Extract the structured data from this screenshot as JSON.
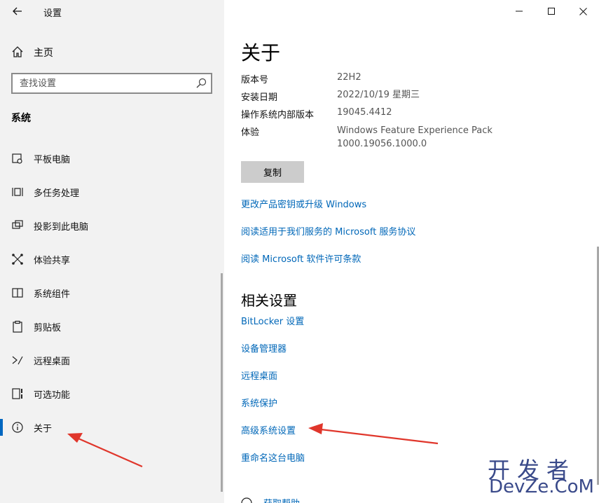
{
  "window": {
    "title": "设置"
  },
  "sidebar": {
    "home_label": "主页",
    "search_placeholder": "查找设置",
    "section": "系统",
    "items": [
      {
        "label": "平板电脑",
        "icon": "tablet-icon"
      },
      {
        "label": "多任务处理",
        "icon": "multitasking-icon"
      },
      {
        "label": "投影到此电脑",
        "icon": "projecting-icon"
      },
      {
        "label": "体验共享",
        "icon": "shared-experiences-icon"
      },
      {
        "label": "系统组件",
        "icon": "system-components-icon"
      },
      {
        "label": "剪贴板",
        "icon": "clipboard-icon"
      },
      {
        "label": "远程桌面",
        "icon": "remote-desktop-icon"
      },
      {
        "label": "可选功能",
        "icon": "optional-features-icon"
      },
      {
        "label": "关于",
        "icon": "info-icon",
        "selected": true
      }
    ]
  },
  "main": {
    "title": "关于",
    "specs": {
      "version_label": "版本号",
      "version_value": "22H2",
      "install_label": "安装日期",
      "install_value": "2022/10/19 星期三",
      "build_label": "操作系统内部版本",
      "build_value": "19045.4412",
      "experience_label": "体验",
      "experience_value_line1": "Windows Feature Experience Pack",
      "experience_value_line2": "1000.19056.1000.0"
    },
    "copy_button": "复制",
    "links": [
      "更改产品密钥或升级 Windows",
      "阅读适用于我们服务的 Microsoft 服务协议",
      "阅读 Microsoft 软件许可条款"
    ],
    "related_title": "相关设置",
    "related_links": [
      "BitLocker 设置",
      "设备管理器",
      "远程桌面",
      "系统保护",
      "高级系统设置",
      "重命名这台电脑"
    ],
    "help_link": "获取帮助"
  },
  "watermark": {
    "cn": "开发者",
    "en": "DevZe.CoM"
  },
  "colors": {
    "accent": "#0067c0",
    "link": "#0067b8",
    "sidebar_bg": "#f2f2f2",
    "annotation_arrow": "#e0362b"
  }
}
